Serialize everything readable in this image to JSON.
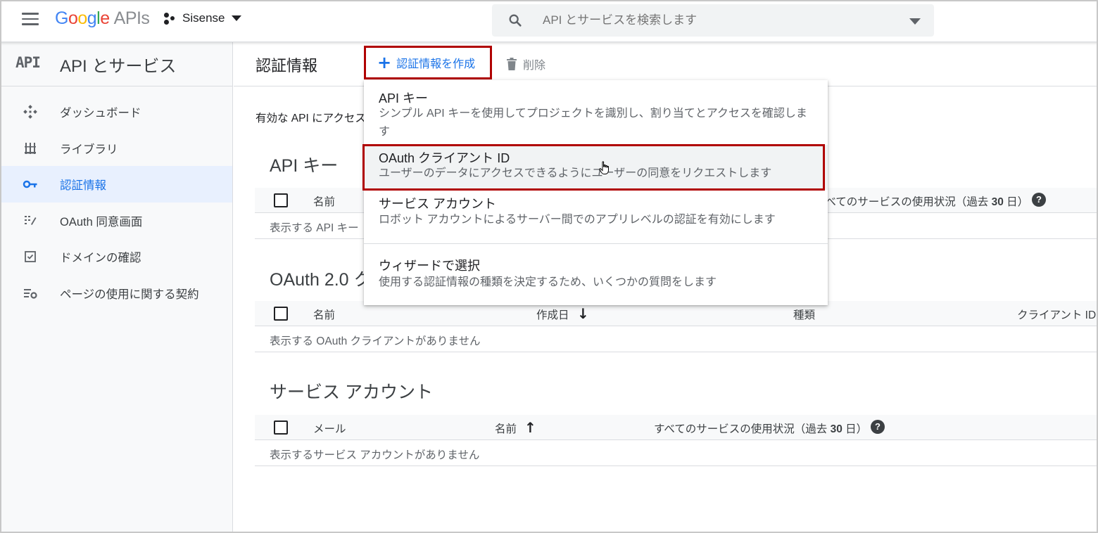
{
  "topbar": {
    "logo_google": [
      "G",
      "o",
      "o",
      "g",
      "l",
      "e"
    ],
    "logo_apis": "APIs",
    "project_name": "Sisense",
    "search_placeholder": "API とサービスを検索します"
  },
  "sidebar": {
    "icon_text": "API",
    "title": "API とサービス",
    "items": [
      {
        "label": "ダッシュボード",
        "icon": "dashboard-icon",
        "active": false
      },
      {
        "label": "ライブラリ",
        "icon": "library-icon",
        "active": false
      },
      {
        "label": "認証情報",
        "icon": "key-icon",
        "active": true
      },
      {
        "label": "OAuth 同意画面",
        "icon": "consent-icon",
        "active": false
      },
      {
        "label": "ドメインの確認",
        "icon": "checkbox-icon",
        "active": false
      },
      {
        "label": "ページの使用に関する契約",
        "icon": "settings-list-icon",
        "active": false
      }
    ]
  },
  "main": {
    "title": "認証情報",
    "create_label": "認証情報を作成",
    "delete_label": "削除",
    "intro": "有効な API にアクセス"
  },
  "sections": {
    "api_keys": {
      "title": "API キー",
      "col_name": "名前",
      "col_usage": "すべてのサービスの使用状況（過去 ",
      "col_usage_bold": "30",
      "col_usage_end": " 日）",
      "empty": "表示する API キー"
    },
    "oauth": {
      "title": "OAuth 2.0 ク",
      "col_name": "名前",
      "col_created": "作成日",
      "col_type": "種類",
      "col_client": "クライアント ID",
      "empty": "表示する OAuth クライアントがありません"
    },
    "service": {
      "title": "サービス アカウント",
      "col_email": "メール",
      "col_name": "名前",
      "col_usage": "すべてのサービスの使用状況（過去 ",
      "col_usage_bold": "30",
      "col_usage_end": " 日）",
      "empty": "表示するサービス アカウントがありません"
    }
  },
  "menu": {
    "items": [
      {
        "title": "API キー",
        "desc": "シンプル API キーを使用してプロジェクトを識別し、割り当てとアクセスを確認します"
      },
      {
        "title": "OAuth クライアント ID",
        "desc": "ユーザーのデータにアクセスできるようにユーザーの同意をリクエストします"
      },
      {
        "title": "サービス アカウント",
        "desc": "ロボット アカウントによるサーバー間でのアプリレベルの認証を有効にします"
      },
      {
        "title": "ウィザードで選択",
        "desc": "使用する認証情報の種類を決定するため、いくつかの質問をします"
      }
    ]
  },
  "colors": {
    "accent": "#1a73e8",
    "highlight_border": "#b00000",
    "active_bg": "#e8f0fe"
  }
}
